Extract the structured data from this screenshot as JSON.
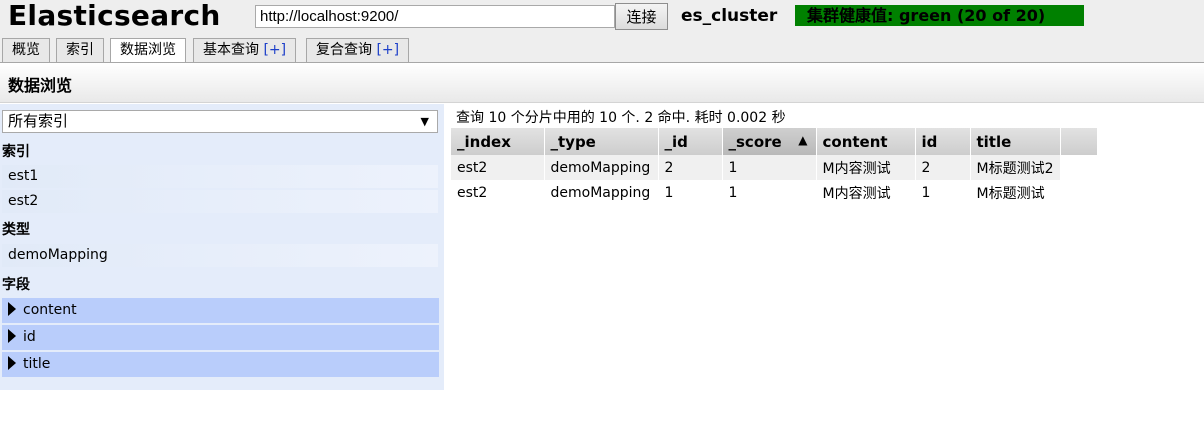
{
  "app": {
    "title": "Elasticsearch",
    "url": "http://localhost:9200/",
    "connect_label": "连接",
    "cluster_name": "es_cluster",
    "health": "集群健康值: green (20 of 20)",
    "health_color": "#008000"
  },
  "tabs": [
    {
      "label": "概览",
      "plus": ""
    },
    {
      "label": "索引",
      "plus": ""
    },
    {
      "label": "数据浏览",
      "plus": ""
    },
    {
      "label": "基本查询 ",
      "plus": "[+]"
    },
    {
      "label": "复合查询 ",
      "plus": "[+]"
    }
  ],
  "active_tab": "数据浏览",
  "section_title": "数据浏览",
  "sidebar": {
    "index_select": "所有索引",
    "index_label": "索引",
    "indices": [
      "est1",
      "est2"
    ],
    "type_label": "类型",
    "types": [
      "demoMapping"
    ],
    "field_label": "字段",
    "fields": [
      "content",
      "id",
      "title"
    ]
  },
  "results": {
    "summary": "查询 10 个分片中用的 10 个. 2 命中. 耗时 0.002 秒",
    "columns": [
      "_index",
      "_type",
      "_id",
      "_score",
      "content",
      "id",
      "title"
    ],
    "sorted_column": "_score",
    "sort_arrow": "▲",
    "rows": [
      [
        "est2",
        "demoMapping",
        "2",
        "1",
        "M内容测试",
        "2",
        "M标题测试2"
      ],
      [
        "est2",
        "demoMapping",
        "1",
        "1",
        "M内容测试",
        "1",
        "M标题测试"
      ]
    ]
  }
}
